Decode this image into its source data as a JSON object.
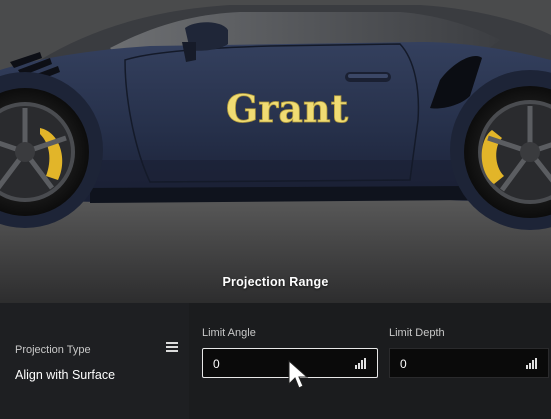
{
  "scene": {
    "decal_text": "Grant",
    "decal_color": "#f0dc73",
    "car_color": "#26304a",
    "caliper_color": "#e2b529",
    "range_label": "Projection Range"
  },
  "panel": {
    "projection_type": {
      "label": "Projection Type",
      "value": "Align with Surface",
      "icon": "menu-icon"
    },
    "limit_angle": {
      "label": "Limit Angle",
      "value": "0",
      "icon": "bars-icon",
      "state": "focused"
    },
    "limit_depth": {
      "label": "Limit Depth",
      "value": "0",
      "icon": "bars-icon"
    }
  },
  "colors": {
    "panel_bg": "#1b1c1e",
    "field_bg": "#0a0a0a",
    "field_focus_border": "#e8e8e8",
    "text": "#ffffff"
  }
}
